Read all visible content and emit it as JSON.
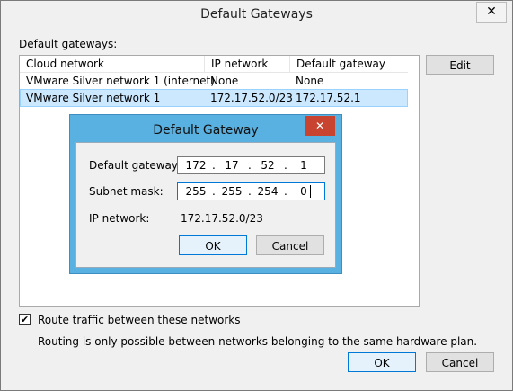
{
  "window": {
    "title": "Default Gateways",
    "close_glyph": "✕"
  },
  "main": {
    "gateways_label": "Default gateways:",
    "columns": [
      "Cloud network",
      "IP network",
      "Default gateway"
    ],
    "rows": [
      {
        "cloud": "VMware Silver network 1 (internet)",
        "ip": "None",
        "gw": "None"
      },
      {
        "cloud": "VMware Silver network 1",
        "ip": "172.17.52.0/23",
        "gw": "172.17.52.1"
      }
    ],
    "edit_label": "Edit",
    "route_label": "Route traffic between these networks",
    "route_checked": true,
    "note": "Routing is only possible between networks belonging to the same hardware plan.",
    "ok_label": "OK",
    "cancel_label": "Cancel"
  },
  "dialog": {
    "title": "Default Gateway",
    "close_glyph": "✕",
    "gateway_label": "Default gateway:",
    "gateway_octets": [
      "172",
      "17",
      "52",
      "1"
    ],
    "mask_label": "Subnet mask:",
    "mask_octets": [
      "255",
      "255",
      "254",
      "0"
    ],
    "ipnet_label": "IP network:",
    "ipnet_value": "172.17.52.0/23",
    "ok_label": "OK",
    "cancel_label": "Cancel",
    "dot": "."
  }
}
